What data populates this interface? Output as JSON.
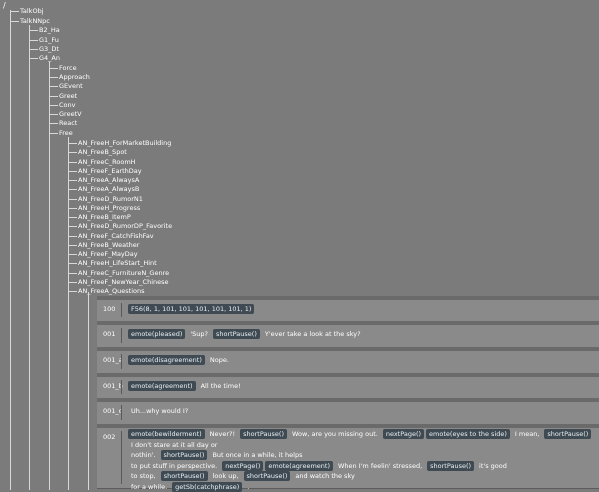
{
  "root": "/",
  "tree": {
    "level0": [
      "TalkObj",
      "TalkNNpc"
    ],
    "level1": [
      "B2_Ha",
      "G1_Fu",
      "G3_Dt",
      "G4_An"
    ],
    "level2": [
      "Force",
      "Approach",
      "GEvent",
      "Greet",
      "Conv",
      "GreetV",
      "React",
      "Free"
    ],
    "level3": [
      "AN_FreeH_ForMarketBuilding",
      "AN_FreeB_Spot",
      "AN_FreeC_RoomH",
      "AN_FreeF_EarthDay",
      "AN_FreeA_AlwaysA",
      "AN_FreeA_AlwaysB",
      "AN_FreeD_RumorN1",
      "AN_FreeH_Progress",
      "AN_FreeB_ItemP",
      "AN_FreeD_RumorDP_Favorite",
      "AN_FreeF_CatchFishFav",
      "AN_FreeB_Weather",
      "AN_FreeF_MayDay",
      "AN_FreeH_LifeStart_Hint",
      "AN_FreeC_FurnitureN_Genre",
      "AN_FreeF_NewYear_Chinese",
      "AN_FreeA_Questions"
    ]
  },
  "panels": [
    {
      "id": "100",
      "lines": [
        [
          {
            "tag": "F56(8, 1, 101, 101, 101, 101, 101, 1)"
          }
        ]
      ]
    },
    {
      "id": "001",
      "lines": [
        [
          {
            "tag": "emote(pleased)"
          },
          {
            "text": "'Sup?"
          },
          {
            "tag": "shortPause()"
          },
          {
            "text": "Y'ever take a look at the sky?"
          }
        ]
      ]
    },
    {
      "id": "001_a",
      "lines": [
        [
          {
            "tag": "emote(disagreement)"
          },
          {
            "text": "Nope."
          }
        ]
      ]
    },
    {
      "id": "001_b",
      "lines": [
        [
          {
            "tag": "emote(agreement)"
          },
          {
            "text": "All the time!"
          }
        ]
      ]
    },
    {
      "id": "001_c",
      "lines": [
        [
          {
            "text": "Uh...why would I?"
          }
        ]
      ]
    },
    {
      "id": "002",
      "lines": [
        [
          {
            "tag": "emote(bewilderment)"
          },
          {
            "text": "Never?!"
          },
          {
            "tag": "shortPause()"
          },
          {
            "text": "Wow, are you missing out."
          },
          {
            "tag": "nextPage()"
          },
          {
            "tag": "emote(eyes to the side)"
          },
          {
            "text": "I mean,"
          },
          {
            "tag": "shortPause()"
          },
          {
            "text": "I don't stare at it all day or"
          }
        ],
        [
          {
            "text": "nothin'."
          },
          {
            "tag": "shortPause()"
          },
          {
            "text": "But once in a while, it helps"
          }
        ],
        [
          {
            "text": "to put stuff in perspective."
          },
          {
            "tag": "nextPage()"
          },
          {
            "tag": "emote(agreement)"
          },
          {
            "text": "When I'm feelin' stressed,"
          },
          {
            "tag": "shortPause()"
          },
          {
            "text": "it's good"
          }
        ],
        [
          {
            "text": "to stop,"
          },
          {
            "tag": "shortPause()"
          },
          {
            "text": "look up,"
          },
          {
            "tag": "shortPause()"
          },
          {
            "text": "and watch the sky"
          }
        ],
        [
          {
            "text": "for a while."
          },
          {
            "tag": "getSb(catchphrase)"
          },
          {
            "text": "."
          }
        ]
      ]
    }
  ]
}
